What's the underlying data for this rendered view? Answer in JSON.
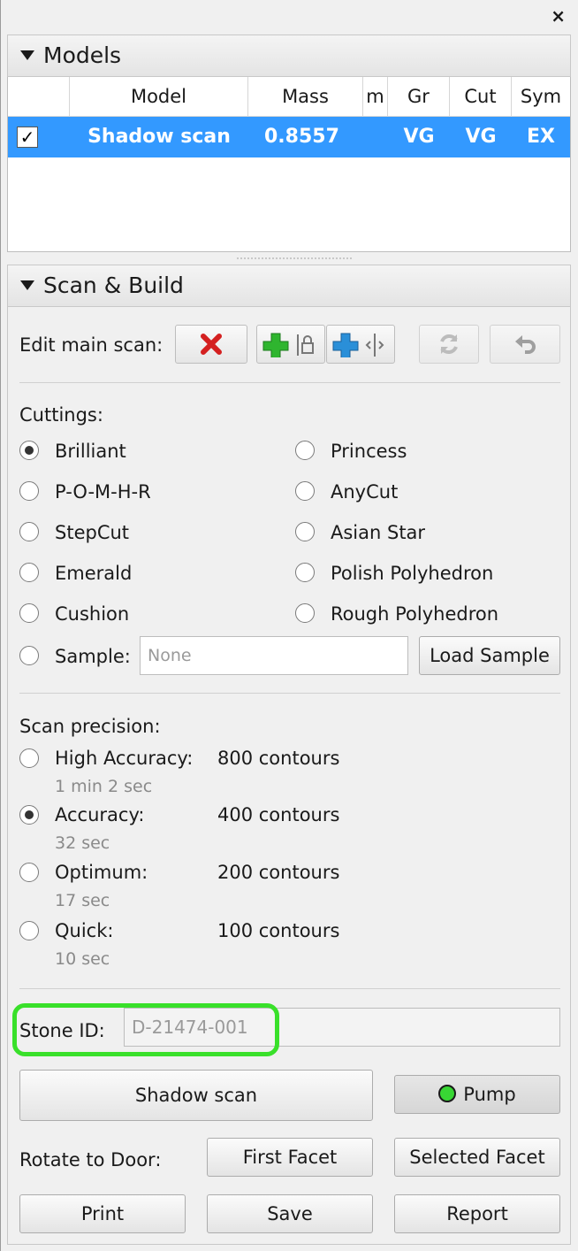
{
  "window": {
    "close_glyph": "×"
  },
  "models": {
    "header": "Models",
    "columns": [
      "Model",
      "Mass",
      "m",
      "Gr",
      "Cut",
      "Sym"
    ],
    "rows": [
      {
        "checked": true,
        "model": "Shadow scan",
        "mass": "0.8557",
        "m": "",
        "gr": "VG",
        "cut": "VG",
        "sym": "EX"
      }
    ]
  },
  "scan_build": {
    "header": "Scan & Build",
    "edit_main_scan_label": "Edit main scan:",
    "edit_buttons": [
      {
        "icon": "delete-x-icon",
        "enabled": true
      },
      {
        "icon": "add-lock-icon",
        "enabled": true
      },
      {
        "icon": "add-split-icon",
        "enabled": true
      },
      {
        "icon": "refresh-icon",
        "enabled": false
      },
      {
        "icon": "undo-icon",
        "enabled": false
      }
    ],
    "cuttings_label": "Cuttings:",
    "cuttings": [
      {
        "label": "Brilliant",
        "checked": true
      },
      {
        "label": "Princess",
        "checked": false
      },
      {
        "label": "P-O-M-H-R",
        "checked": false
      },
      {
        "label": "AnyCut",
        "checked": false
      },
      {
        "label": "StepCut",
        "checked": false
      },
      {
        "label": "Asian Star",
        "checked": false
      },
      {
        "label": "Emerald",
        "checked": false
      },
      {
        "label": "Polish Polyhedron",
        "checked": false
      },
      {
        "label": "Cushion",
        "checked": false
      },
      {
        "label": "Rough Polyhedron",
        "checked": false
      }
    ],
    "sample_label": "Sample:",
    "sample_placeholder": "None",
    "load_sample_button": "Load Sample",
    "scan_precision_label": "Scan precision:",
    "precisions": [
      {
        "label": "High Accuracy:",
        "contours": "800 contours",
        "time": "1 min 2 sec",
        "checked": false
      },
      {
        "label": "Accuracy:",
        "contours": "400 contours",
        "time": "32 sec",
        "checked": true
      },
      {
        "label": "Optimum:",
        "contours": "200 contours",
        "time": "17 sec",
        "checked": false
      },
      {
        "label": "Quick:",
        "contours": "100 contours",
        "time": "10 sec",
        "checked": false
      }
    ],
    "stone_id_label": "Stone ID:",
    "stone_id_value": "D-21474-001",
    "shadow_scan_button": "Shadow scan",
    "pump_button": "Pump",
    "pump_status_color": "#38d634",
    "rotate_label": "Rotate to Door:",
    "first_facet_button": "First Facet",
    "selected_facet_button": "Selected Facet",
    "print_button": "Print",
    "save_button": "Save",
    "report_button": "Report",
    "highlight_color": "#39e02a",
    "selection_color": "#3399ff"
  }
}
